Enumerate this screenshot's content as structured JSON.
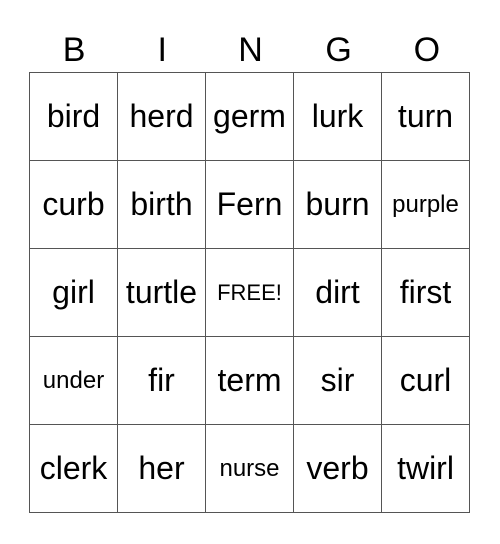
{
  "header": [
    "B",
    "I",
    "N",
    "G",
    "O"
  ],
  "rows": [
    [
      "bird",
      "herd",
      "germ",
      "lurk",
      "turn"
    ],
    [
      "curb",
      "birth",
      "Fern",
      "burn",
      "purple"
    ],
    [
      "girl",
      "turtle",
      "FREE!",
      "dirt",
      "first"
    ],
    [
      "under",
      "fir",
      "term",
      "sir",
      "curl"
    ],
    [
      "clerk",
      "her",
      "nurse",
      "verb",
      "twirl"
    ]
  ]
}
